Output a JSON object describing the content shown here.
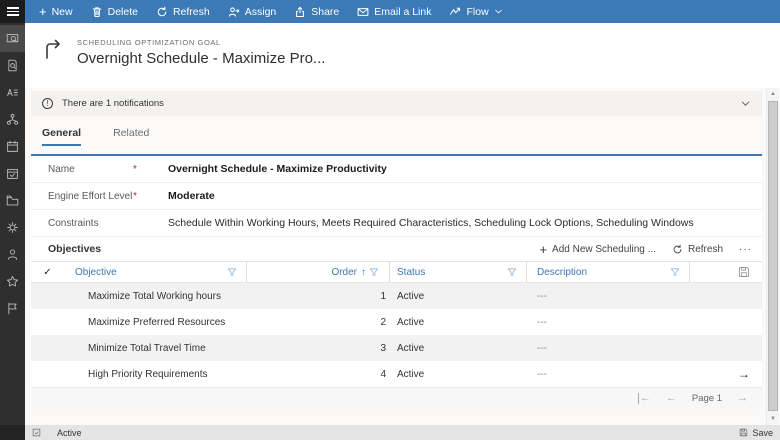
{
  "colors": {
    "topbar": "#3b79b7",
    "accent": "#3b79b7",
    "sidebar": "#2f2f2f",
    "required": "#a4262c",
    "grid_link": "#3b78b5"
  },
  "command_bar": {
    "items": [
      {
        "label": "New",
        "icon": "plus-icon"
      },
      {
        "label": "Delete",
        "icon": "trash-icon"
      },
      {
        "label": "Refresh",
        "icon": "refresh-icon"
      },
      {
        "label": "Assign",
        "icon": "assign-icon"
      },
      {
        "label": "Share",
        "icon": "share-icon"
      },
      {
        "label": "Email a Link",
        "icon": "email-icon"
      },
      {
        "label": "Flow",
        "icon": "flow-icon",
        "has_dropdown": true
      }
    ]
  },
  "record_header": {
    "entity_label": "SCHEDULING OPTIMIZATION GOAL",
    "title": "Overnight Schedule - Maximize Pro..."
  },
  "notification": {
    "text": "There are 1 notifications",
    "info_glyph": "!"
  },
  "tabs": [
    {
      "label": "General",
      "active": true
    },
    {
      "label": "Related",
      "active": false
    }
  ],
  "form": {
    "required_marker": "*",
    "fields": [
      {
        "label": "Name",
        "required": true,
        "value": "Overnight Schedule - Maximize Productivity"
      },
      {
        "label": "Engine Effort Level",
        "required": true,
        "value": "Moderate"
      },
      {
        "label": "Constraints",
        "required": false,
        "value": "Schedule Within Working Hours, Meets Required Characteristics, Scheduling Lock Options, Scheduling Windows"
      }
    ]
  },
  "objectives": {
    "section_title": "Objectives",
    "toolbar": {
      "add_label": "Add New Scheduling ...",
      "refresh_label": "Refresh",
      "more_glyph": "···"
    },
    "grid": {
      "select_all_glyph": "✓",
      "sort_arrow": "↑",
      "columns": [
        "Objective",
        "Order",
        "Status",
        "Description"
      ],
      "rows": [
        {
          "objective": "Maximize Total Working hours",
          "order": "1",
          "status": "Active",
          "description": "---"
        },
        {
          "objective": "Maximize Preferred Resources",
          "order": "2",
          "status": "Active",
          "description": "---"
        },
        {
          "objective": "Minimize Total Travel Time",
          "order": "3",
          "status": "Active",
          "description": "---"
        },
        {
          "objective": "High Priority Requirements",
          "order": "4",
          "status": "Active",
          "description": "---"
        }
      ],
      "row_scroll_arrow": "→"
    },
    "pagination": {
      "label": "Page 1",
      "prev_glyph": "←",
      "next_glyph": "→",
      "first_glyph": "←"
    }
  },
  "scrollbar": {
    "up_glyph": "▲",
    "down_glyph": "▼"
  },
  "status_bar": {
    "state": "Active",
    "save_label": "Save"
  }
}
